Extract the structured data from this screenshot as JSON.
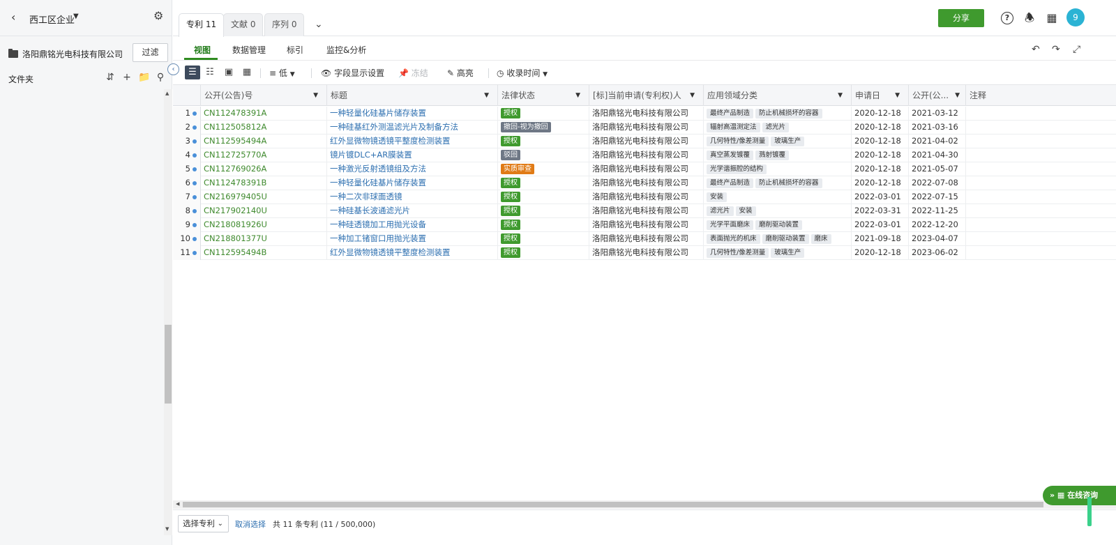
{
  "sidebar": {
    "title": "西工区企业",
    "company": "洛阳鼎铭光电科技有限公司",
    "filter_label": "过滤",
    "folders_label": "文件夹"
  },
  "tabs": [
    {
      "label": "专利 11"
    },
    {
      "label": "文献 0"
    },
    {
      "label": "序列 0"
    }
  ],
  "header": {
    "share_label": "分享",
    "avatar_text": "9"
  },
  "subnav": {
    "items": [
      "视图",
      "数据管理",
      "标引",
      "监控&分析"
    ]
  },
  "toolbar": {
    "density_label": "低",
    "fields_label": "字段显示设置",
    "freeze_label": "冻结",
    "highlight_label": "高亮",
    "sort_label": "收录时间"
  },
  "table": {
    "columns": [
      "公开(公告)号",
      "标题",
      "法律状态",
      "[标]当前申请(专利权)人",
      "应用领域分类",
      "申请日",
      "公开(公...",
      "注释"
    ],
    "rows": [
      {
        "idx": "1",
        "pubno": "CN112478391A",
        "title": "一种轻量化硅基片储存装置",
        "status": "授权",
        "status_color": "green",
        "applicant": "洛阳鼎铭光电科技有限公司",
        "tags": [
          "最终产品制造",
          "防止机械损坏的容器"
        ],
        "app_date": "2020-12-18",
        "pub_date": "2021-03-12"
      },
      {
        "idx": "2",
        "pubno": "CN112505812A",
        "title": "一种硅基红外测温滤光片及制备方法",
        "status": "撤回-视为撤回",
        "status_color": "gray",
        "applicant": "洛阳鼎铭光电科技有限公司",
        "tags": [
          "辐射高温测定法",
          "滤光片"
        ],
        "app_date": "2020-12-18",
        "pub_date": "2021-03-16"
      },
      {
        "idx": "3",
        "pubno": "CN112595494A",
        "title": "红外显微物镜透镜平整度检测装置",
        "status": "授权",
        "status_color": "green",
        "applicant": "洛阳鼎铭光电科技有限公司",
        "tags": [
          "几何特性/像差测量",
          "玻璃生产"
        ],
        "app_date": "2020-12-18",
        "pub_date": "2021-04-02"
      },
      {
        "idx": "4",
        "pubno": "CN112725770A",
        "title": "镜片镀DLC+AR膜装置",
        "status": "驳回",
        "status_color": "gray",
        "applicant": "洛阳鼎铭光电科技有限公司",
        "tags": [
          "真空蒸发镀覆",
          "溅射镀覆"
        ],
        "app_date": "2020-12-18",
        "pub_date": "2021-04-30"
      },
      {
        "idx": "5",
        "pubno": "CN112769026A",
        "title": "一种激光反射透镜组及方法",
        "status": "实质审查",
        "status_color": "orange",
        "applicant": "洛阳鼎铭光电科技有限公司",
        "tags": [
          "光学谐振腔的结构"
        ],
        "app_date": "2020-12-18",
        "pub_date": "2021-05-07"
      },
      {
        "idx": "6",
        "pubno": "CN112478391B",
        "title": "一种轻量化硅基片储存装置",
        "status": "授权",
        "status_color": "green",
        "applicant": "洛阳鼎铭光电科技有限公司",
        "tags": [
          "最终产品制造",
          "防止机械损坏的容器"
        ],
        "app_date": "2020-12-18",
        "pub_date": "2022-07-08"
      },
      {
        "idx": "7",
        "pubno": "CN216979405U",
        "title": "一种二次非球面透镜",
        "status": "授权",
        "status_color": "green",
        "applicant": "洛阳鼎铭光电科技有限公司",
        "tags": [
          "安装"
        ],
        "app_date": "2022-03-01",
        "pub_date": "2022-07-15"
      },
      {
        "idx": "8",
        "pubno": "CN217902140U",
        "title": "一种硅基长波通滤光片",
        "status": "授权",
        "status_color": "green",
        "applicant": "洛阳鼎铭光电科技有限公司",
        "tags": [
          "滤光片",
          "安装"
        ],
        "app_date": "2022-03-31",
        "pub_date": "2022-11-25"
      },
      {
        "idx": "9",
        "pubno": "CN218081926U",
        "title": "一种硅透镜加工用抛光设备",
        "status": "授权",
        "status_color": "green",
        "applicant": "洛阳鼎铭光电科技有限公司",
        "tags": [
          "光学平面磨床",
          "磨削驱动装置"
        ],
        "app_date": "2022-03-01",
        "pub_date": "2022-12-20"
      },
      {
        "idx": "10",
        "pubno": "CN218801377U",
        "title": "一种加工锗窗口用抛光装置",
        "status": "授权",
        "status_color": "green",
        "applicant": "洛阳鼎铭光电科技有限公司",
        "tags": [
          "表面抛光的机床",
          "磨削驱动装置",
          "磨床"
        ],
        "app_date": "2021-09-18",
        "pub_date": "2023-04-07"
      },
      {
        "idx": "11",
        "pubno": "CN112595494B",
        "title": "红外显微物镜透镜平整度检测装置",
        "status": "授权",
        "status_color": "green",
        "applicant": "洛阳鼎铭光电科技有限公司",
        "tags": [
          "几何特性/像差测量",
          "玻璃生产"
        ],
        "app_date": "2020-12-18",
        "pub_date": "2023-06-02"
      }
    ]
  },
  "footer": {
    "select_label": "选择专利",
    "cancel_label": "取消选择",
    "count_text": "共 11 条专利 (11 / 500,000)"
  },
  "chat": {
    "label": "在线咨询"
  },
  "colors": {
    "brand_green": "#3f9a2e",
    "link_blue": "#2d6fb0",
    "status_gray": "#6e7785",
    "status_orange": "#e07b16",
    "avatar_blue": "#2bb3d4"
  }
}
